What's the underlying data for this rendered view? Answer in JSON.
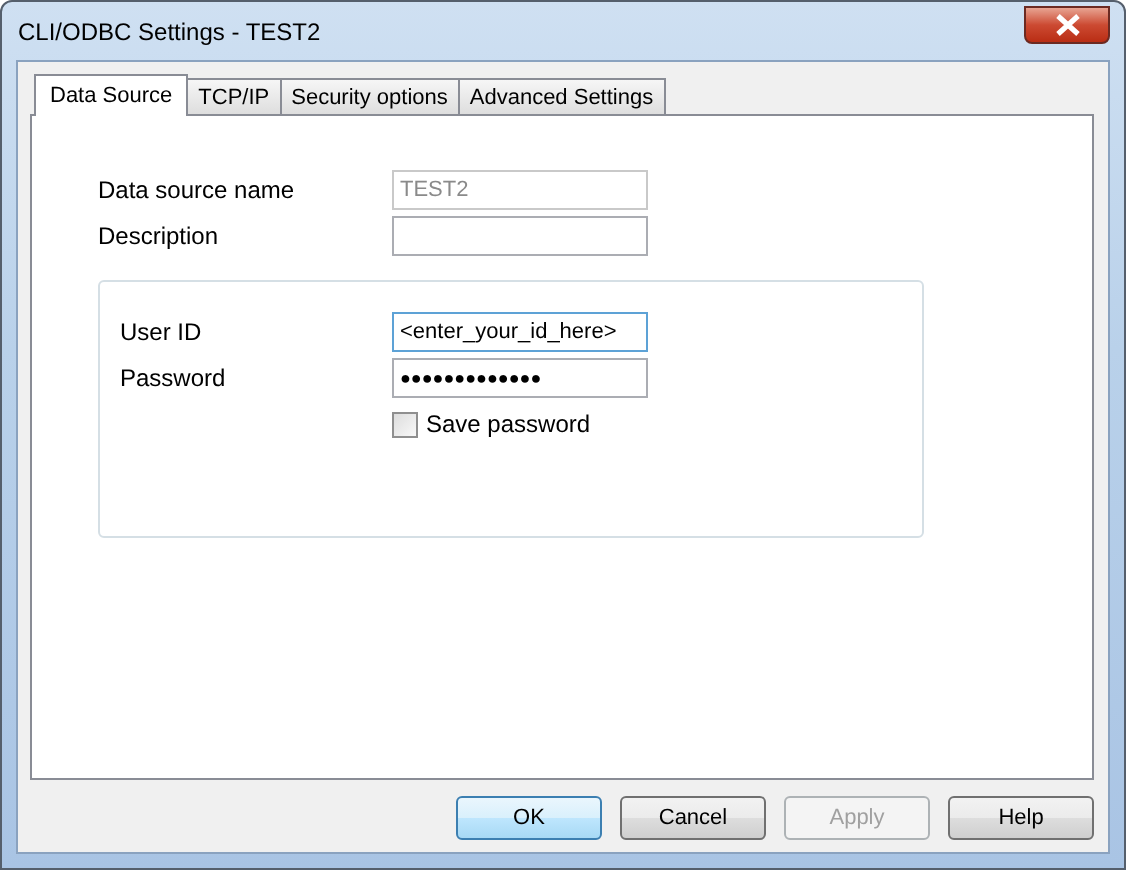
{
  "window": {
    "title": "CLI/ODBC Settings - TEST2"
  },
  "tabs": [
    {
      "label": "Data Source",
      "selected": true
    },
    {
      "label": "TCP/IP",
      "selected": false
    },
    {
      "label": "Security options",
      "selected": false
    },
    {
      "label": "Advanced Settings",
      "selected": false
    }
  ],
  "source_fields": [
    {
      "label": "Data source name",
      "value": "TEST2",
      "disabled": true
    },
    {
      "label": "Description",
      "disabled": false
    }
  ],
  "login_fields": [
    {
      "label": "User ID",
      "value": "<enter_your_id_here>",
      "focused": true,
      "kind": "text"
    },
    {
      "label": "Password",
      "value": "●●●●●●●●●●●●●",
      "focused": false,
      "kind": "password"
    }
  ],
  "save_password": {
    "label": "Save password",
    "checked": false
  },
  "buttons": [
    {
      "label": "OK",
      "default": true,
      "disabled": false
    },
    {
      "label": "Cancel",
      "default": false,
      "disabled": false
    },
    {
      "label": "Apply",
      "default": false,
      "disabled": true
    },
    {
      "label": "Help",
      "default": false,
      "disabled": false
    }
  ]
}
